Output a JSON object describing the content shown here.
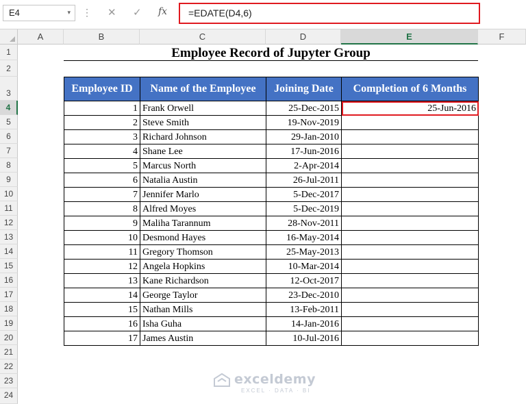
{
  "formula_bar": {
    "name_box": "E4",
    "name_box_dropdown": "▾",
    "more_dots": "⋮",
    "cancel_glyph": "✕",
    "enter_glyph": "✓",
    "fx_label": "fx",
    "formula": "=EDATE(D4,6)"
  },
  "columns": [
    "A",
    "B",
    "C",
    "D",
    "E",
    "F"
  ],
  "selected_column": "E",
  "rows": [
    "1",
    "2",
    "3",
    "4",
    "5",
    "6",
    "7",
    "8",
    "9",
    "10",
    "11",
    "12",
    "13",
    "14",
    "15",
    "16",
    "17",
    "18",
    "19",
    "20",
    "21",
    "22",
    "23",
    "24"
  ],
  "selected_row": "4",
  "sheet": {
    "title": "Employee Record of Jupyter Group",
    "headers": [
      "Employee ID",
      "Name of the Employee",
      "Joining Date",
      "Completion of 6 Months"
    ],
    "records": [
      {
        "id": "1",
        "name": "Frank Orwell",
        "date": "25-Dec-2015",
        "result": "25-Jun-2016"
      },
      {
        "id": "2",
        "name": "Steve Smith",
        "date": "19-Nov-2019",
        "result": ""
      },
      {
        "id": "3",
        "name": "Richard Johnson",
        "date": "29-Jan-2010",
        "result": ""
      },
      {
        "id": "4",
        "name": "Shane Lee",
        "date": "17-Jun-2016",
        "result": ""
      },
      {
        "id": "5",
        "name": "Marcus North",
        "date": "2-Apr-2014",
        "result": ""
      },
      {
        "id": "6",
        "name": "Natalia Austin",
        "date": "26-Jul-2011",
        "result": ""
      },
      {
        "id": "7",
        "name": "Jennifer Marlo",
        "date": "5-Dec-2017",
        "result": ""
      },
      {
        "id": "8",
        "name": "Alfred Moyes",
        "date": "5-Dec-2019",
        "result": ""
      },
      {
        "id": "9",
        "name": "Maliha Tarannum",
        "date": "28-Nov-2011",
        "result": ""
      },
      {
        "id": "10",
        "name": "Desmond Hayes",
        "date": "16-May-2014",
        "result": ""
      },
      {
        "id": "11",
        "name": "Gregory Thomson",
        "date": "25-May-2013",
        "result": ""
      },
      {
        "id": "12",
        "name": "Angela Hopkins",
        "date": "10-Mar-2014",
        "result": ""
      },
      {
        "id": "13",
        "name": "Kane Richardson",
        "date": "12-Oct-2017",
        "result": ""
      },
      {
        "id": "14",
        "name": "George Taylor",
        "date": "23-Dec-2010",
        "result": ""
      },
      {
        "id": "15",
        "name": "Nathan Mills",
        "date": "13-Feb-2011",
        "result": ""
      },
      {
        "id": "16",
        "name": "Isha Guha",
        "date": "14-Jan-2016",
        "result": ""
      },
      {
        "id": "17",
        "name": "James Austin",
        "date": "10-Jul-2016",
        "result": ""
      }
    ]
  },
  "watermark": {
    "name": "exceldemy",
    "tagline": "EXCEL · DATA · BI"
  },
  "colors": {
    "header_fill": "#4472c4",
    "highlight": "#e0191f",
    "excel_green": "#217346"
  },
  "icons": [
    "dropdown-arrow-icon",
    "cancel-icon",
    "enter-check-icon",
    "function-fx-icon",
    "exceldemy-logo-icon"
  ]
}
